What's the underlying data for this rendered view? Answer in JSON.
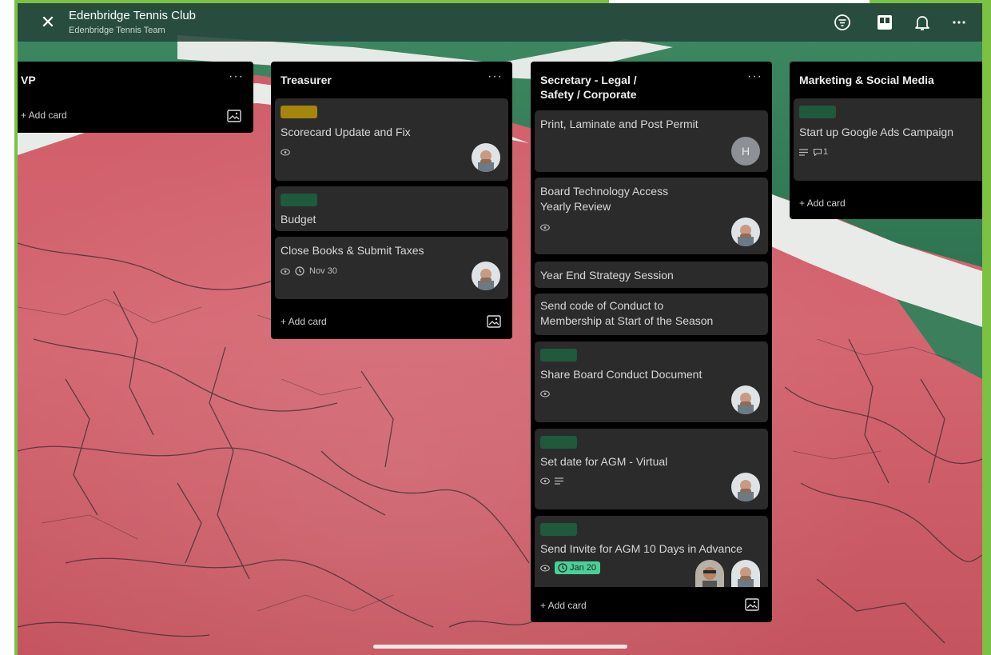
{
  "header": {
    "title": "Edenbridge Tennis Club",
    "subtitle": "Edenbridge Tennis Team",
    "close_icon": "close-icon",
    "actions": [
      "filter-icon",
      "board-view-icon",
      "bell-icon",
      "more-icon"
    ]
  },
  "colors": {
    "label_yellow": "#a6850d",
    "label_green": "#1e5a3b",
    "due_green": "#4bce97",
    "list_bg": "#000000",
    "card_bg": "#2b2b2c",
    "accent_frame": "#7cc142"
  },
  "lists": {
    "vp": {
      "title": "VP",
      "add_card": "+ Add card"
    },
    "treasurer": {
      "title": "Treasurer",
      "add_card": "+ Add card",
      "cards": [
        {
          "title": "Scorecard Update and Fix"
        },
        {
          "title": "Budget"
        },
        {
          "title": "Close Books & Submit Taxes",
          "due": "Nov 30"
        }
      ]
    },
    "secretary": {
      "title_line1": "Secretary - Legal /",
      "title_line2": "Safety / Corporate",
      "add_card": "+ Add card",
      "cards": [
        {
          "title": "Print, Laminate and Post Permit",
          "avatar_initial": "H"
        },
        {
          "title_line1": "Board Technology Access",
          "title_line2": "Yearly Review"
        },
        {
          "title": "Year End Strategy Session"
        },
        {
          "title_line1": "Send code of Conduct to",
          "title_line2": "Membership at Start of the Season"
        },
        {
          "title": "Share Board Conduct Document"
        },
        {
          "title": "Set date for AGM - Virtual"
        },
        {
          "title": "Send Invite for AGM 10 Days in Advance",
          "due": "Jan 20"
        }
      ]
    },
    "marketing": {
      "title": "Marketing & Social Media",
      "add_card": "+ Add card",
      "cards": [
        {
          "title": "Start up Google Ads Campaign",
          "comments": "1"
        }
      ]
    }
  }
}
